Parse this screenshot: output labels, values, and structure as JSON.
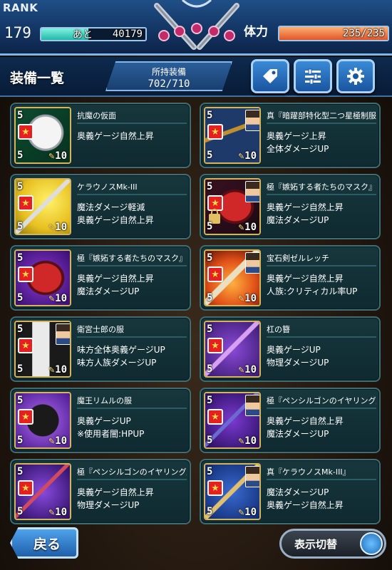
{
  "status": {
    "rank_label": "RANK",
    "rank_value": "179",
    "exp_prefix": "あと",
    "exp_value": "40179",
    "exp_fill_fraction": 0.45,
    "stamina_label": "体力",
    "stamina_value": "235/235",
    "stamina_fill_fraction": 1.0
  },
  "header": {
    "title": "装備一覧",
    "owned_label": "所持装備",
    "owned_count": "702/710",
    "buttons": [
      "tag-icon",
      "sliders-icon",
      "gear-icon"
    ]
  },
  "equipment": [
    {
      "name": "抗魔の仮面",
      "effects": [
        "奥義ゲージ自然上昇",
        ""
      ],
      "level": "5",
      "rarity": "5",
      "count": "10",
      "art": "mask-white",
      "portrait": false,
      "locked": false
    },
    {
      "name": "真『暗躍部特化型二つ星極制服』",
      "effects": [
        "奥義ゲージ上昇",
        "全体ダメージUP"
      ],
      "level": "5",
      "rarity": "5",
      "count": "10",
      "art": "uniform",
      "portrait": true,
      "locked": false
    },
    {
      "name": "ケラウノスMk-III",
      "effects": [
        "魔法ダメージ軽減",
        "奥義ゲージ自然上昇"
      ],
      "level": "5",
      "rarity": "5",
      "count": "10",
      "art": "spear-yellow",
      "portrait": false,
      "locked": false
    },
    {
      "name": "極『嫉妬する者たちのマスク』",
      "effects": [
        "奥義ゲージ自然上昇",
        "魔法ダメージUP"
      ],
      "level": "5",
      "rarity": "5",
      "count": "10",
      "art": "mask-red",
      "portrait": true,
      "locked": true
    },
    {
      "name": "極『嫉妬する者たちのマスク』",
      "effects": [
        "奥義ゲージ自然上昇",
        "魔法ダメージUP"
      ],
      "level": "5",
      "rarity": "5",
      "count": "10",
      "art": "mask-red-purple",
      "portrait": false,
      "locked": false
    },
    {
      "name": "宝石剣ゼルレッチ",
      "effects": [
        "奥義ゲージ自然上昇",
        "人族:クリティカル率UP"
      ],
      "level": "5",
      "rarity": "5",
      "count": "10",
      "art": "sword-fire",
      "portrait": true,
      "locked": false
    },
    {
      "name": "衛宮士郎の服",
      "effects": [
        "味方全体奥義ゲージUP",
        "味方人族ダメージUP"
      ],
      "level": "5",
      "rarity": "5",
      "count": "10",
      "art": "coat",
      "portrait": true,
      "locked": false
    },
    {
      "name": "杠の簪",
      "effects": [
        "奥義ゲージUP",
        "物理ダメージUP"
      ],
      "level": "5",
      "rarity": "5",
      "count": "10",
      "art": "hairpin",
      "portrait": false,
      "locked": false
    },
    {
      "name": "魔王リムルの服",
      "effects": [
        "奥義ゲージUP",
        "※使用者闇:HPUP"
      ],
      "level": "5",
      "rarity": "5",
      "count": "10",
      "art": "dark-coat",
      "portrait": false,
      "locked": false
    },
    {
      "name": "極『ペンシルゴンのイヤリング』",
      "effects": [
        "奥義ゲージ自然上昇",
        "魔法ダメージUP"
      ],
      "level": "5",
      "rarity": "5",
      "count": "10",
      "art": "earring",
      "portrait": true,
      "locked": false
    },
    {
      "name": "極『ペンシルゴンのイヤリング』",
      "effects": [
        "奥義ゲージ自然上昇",
        "物理ダメージUP"
      ],
      "level": "5",
      "rarity": "5",
      "count": "10",
      "art": "earring-purple",
      "portrait": false,
      "locked": false
    },
    {
      "name": "真『ケラウノスMk-III』",
      "effects": [
        "魔法ダメージUP",
        "奥義ゲージ自然上昇"
      ],
      "level": "5",
      "rarity": "5",
      "count": "10",
      "art": "spear-gold",
      "portrait": true,
      "locked": false
    }
  ],
  "footer": {
    "back_label": "戻る",
    "display_toggle_label": "表示切替"
  },
  "colors": {
    "accent_blue": "#1f5faa",
    "card_bg": "#16373d",
    "card_border": "#3e6d74",
    "exp_fill": "#22b8a8",
    "stamina_fill": "#e0552a",
    "star_red": "#e62020"
  }
}
